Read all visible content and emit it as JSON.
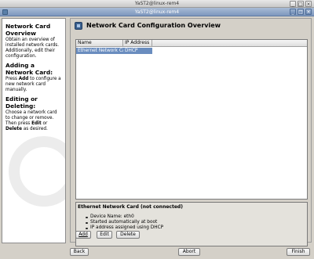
{
  "window": {
    "outer_title": "YaST2@linux-rem4",
    "inner_title": "YaST2@linux-rem4",
    "controls": [
      "_",
      "□",
      "×"
    ]
  },
  "help": {
    "sections": [
      {
        "title": "Network Card Overview",
        "text": "Obtain an overview of installed network cards. Additionally, edit their configuration."
      },
      {
        "title": "Adding a Network Card:",
        "pre": "Press ",
        "key": "Add",
        "post": " to configure a new network card manually."
      },
      {
        "title": "Editing or Deleting:",
        "pre": "Choose a network card to change or remove. Then press ",
        "key": "Edit",
        "mid": " or ",
        "key2": "Delete",
        "post": " as desired."
      }
    ]
  },
  "main": {
    "title": "Network Card Configuration Overview",
    "table": {
      "columns": [
        "Name",
        "IP Address"
      ],
      "rows": [
        [
          "Ethernet Network Card",
          "DHCP"
        ]
      ]
    },
    "details": {
      "title": "Ethernet Network Card (not connected)",
      "items": [
        "Device Name: eth0",
        "Started automatically at boot",
        "IP address assigned using DHCP"
      ]
    },
    "buttons": {
      "add": "Add",
      "edit": "Edit",
      "delete": "Delete"
    }
  },
  "footer": {
    "back": "Back",
    "abort": "Abort",
    "finish": "Finish"
  }
}
